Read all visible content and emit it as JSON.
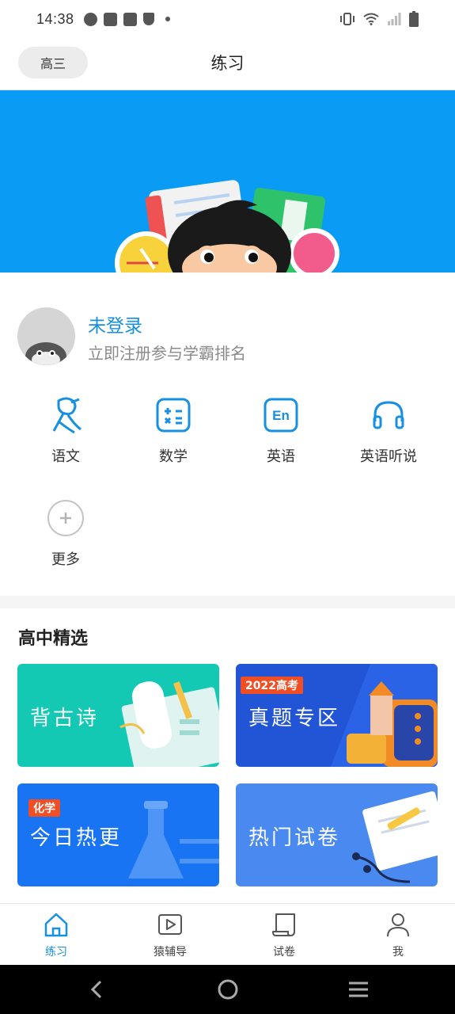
{
  "status_bar": {
    "time": "14:38",
    "left_icons": [
      "speedometer-icon",
      "shopping-bag-icon",
      "shopping-bag-icon",
      "shield-icon",
      "dot-icon"
    ],
    "right_icons": [
      "vibrate-icon",
      "wifi-icon",
      "signal-icon",
      "battery-icon"
    ]
  },
  "header": {
    "grade": "高三",
    "title": "练习"
  },
  "banner": {
    "colors": {
      "background": "#0a9cf5"
    }
  },
  "user": {
    "login_title": "未登录",
    "login_subtitle": "立即注册参与学霸排名"
  },
  "subjects": [
    {
      "label": "语文",
      "icon": "chinese-lady-icon"
    },
    {
      "label": "数学",
      "icon": "calculator-icon"
    },
    {
      "label": "英语",
      "icon": "english-en-icon"
    },
    {
      "label": "英语听说",
      "icon": "headphones-icon"
    },
    {
      "label": "更多",
      "icon": "plus-circle-icon"
    }
  ],
  "section": {
    "title": "高中精选"
  },
  "cards": [
    {
      "title": "背古诗",
      "tag": "",
      "color": "#13c9b4"
    },
    {
      "title": "真题专区",
      "tag": "2022高考",
      "color": "#2254d6"
    },
    {
      "title": "今日热更",
      "tag": "化学",
      "color": "#1874f2"
    },
    {
      "title": "热门试卷",
      "tag": "",
      "color": "#4a8af0"
    }
  ],
  "bottom_nav": [
    {
      "label": "练习",
      "icon": "home-icon",
      "active": true
    },
    {
      "label": "猿辅导",
      "icon": "play-icon",
      "active": false
    },
    {
      "label": "试卷",
      "icon": "scroll-icon",
      "active": false
    },
    {
      "label": "我",
      "icon": "person-icon",
      "active": false
    }
  ],
  "colors": {
    "accent": "#1690e0",
    "muted_text": "#8a8a8a"
  }
}
